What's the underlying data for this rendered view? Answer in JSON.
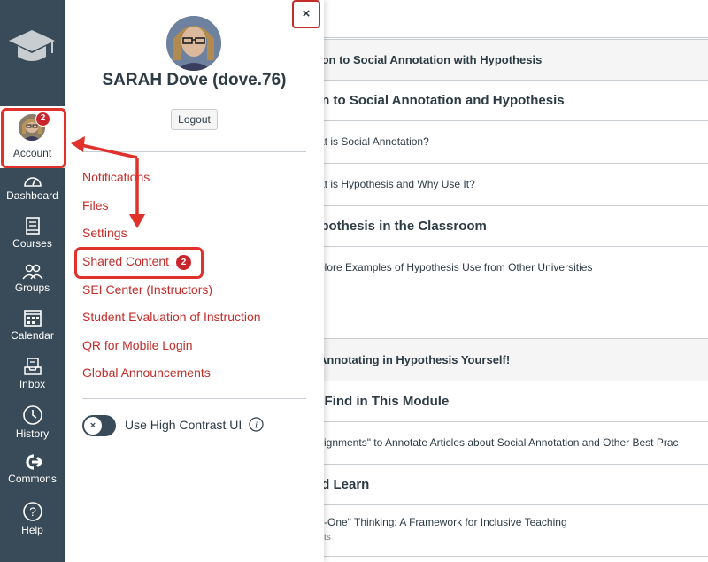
{
  "nav": {
    "account": {
      "label": "Account",
      "badge": "2"
    },
    "items": [
      {
        "label": "Dashboard",
        "icon": "dashboard-icon"
      },
      {
        "label": "Courses",
        "icon": "courses-icon"
      },
      {
        "label": "Groups",
        "icon": "groups-icon"
      },
      {
        "label": "Calendar",
        "icon": "calendar-icon"
      },
      {
        "label": "Inbox",
        "icon": "inbox-icon"
      },
      {
        "label": "History",
        "icon": "history-icon"
      },
      {
        "label": "Commons",
        "icon": "commons-icon"
      },
      {
        "label": "Help",
        "icon": "help-icon"
      }
    ]
  },
  "tray": {
    "close_label": "×",
    "user_name": "SARAH Dove (dove.76)",
    "logout_label": "Logout",
    "links": [
      {
        "label": "Notifications"
      },
      {
        "label": "Files"
      },
      {
        "label": "Settings"
      },
      {
        "label": "Shared Content",
        "badge": "2"
      },
      {
        "label": "SEI Center (Instructors)"
      },
      {
        "label": "Student Evaluation of Instruction"
      },
      {
        "label": "QR for Mobile Login"
      },
      {
        "label": "Global Announcements"
      }
    ],
    "high_contrast": {
      "label": "Use High Contrast UI",
      "toggle_glyph": "×",
      "enabled": false
    }
  },
  "main": {
    "rows": [
      {
        "type": "hdr",
        "text": "ion to Social Annotation with Hypothesis"
      },
      {
        "type": "sub",
        "text": "on to Social Annotation and Hypothesis"
      },
      {
        "type": "item",
        "text": "at is Social Annotation?"
      },
      {
        "type": "item",
        "text": "at is Hypothesis and Why Use It?"
      },
      {
        "type": "sub",
        "text": "ypothesis in the Classroom"
      },
      {
        "type": "item",
        "text": "plore Examples of Hypothesis Use from Other Universities"
      },
      {
        "type": "hdr",
        "text": "Annotating in Hypothesis Yourself!"
      },
      {
        "type": "sub",
        "text": "ll Find in This Module"
      },
      {
        "type": "item",
        "text": "signments\" to Annotate Articles about Social Annotation and Other Best Prac"
      },
      {
        "type": "sub",
        "text": "nd Learn"
      },
      {
        "type": "item",
        "text": "s-One\" Thinking: A Framework for Inclusive Teaching",
        "subtext": "ts"
      }
    ]
  },
  "colors": {
    "nav_bg": "#394b58",
    "link": "#c22d2a",
    "highlight": "#e0312a",
    "badge": "#c8252c"
  }
}
